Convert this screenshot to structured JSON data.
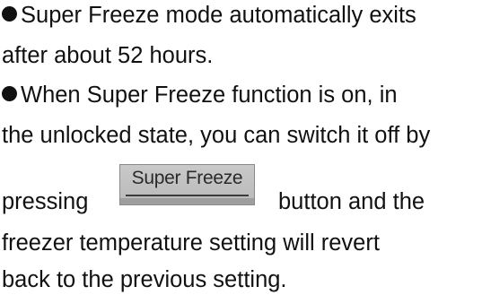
{
  "lines": [
    "Super Freeze mode automatically exits",
    "after about 52 hours.",
    "When Super Freeze function is on, in",
    "the unlocked state, you can switch it off by",
    "pressing",
    "button and the",
    "freezer temperature setting will revert",
    "back to the previous setting."
  ],
  "button": {
    "label": "Super Freeze"
  },
  "colors": {
    "text": "#111111",
    "button_bg": "#c2c2c2"
  }
}
